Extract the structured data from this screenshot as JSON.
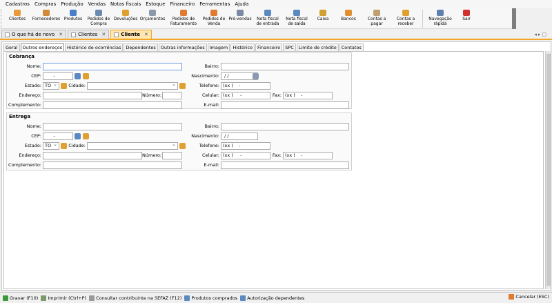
{
  "menu": [
    "Cadastros",
    "Compras",
    "Produção",
    "Vendas",
    "Notas fiscais",
    "Estoque",
    "Financeiro",
    "Ferramentas",
    "Ajuda"
  ],
  "toolbar": [
    {
      "label": "Clientes",
      "icon": "user-icon",
      "color": "#e89a3c"
    },
    {
      "label": "Fornecedores",
      "icon": "supplier-icon",
      "color": "#d08a3a"
    },
    {
      "label": "Produtos",
      "icon": "box-icon",
      "color": "#4a7ec9"
    },
    {
      "label": "Pedidos de\nCompra",
      "icon": "purchase-order-icon",
      "color": "#6a8ab0"
    },
    {
      "label": "Devoluções",
      "icon": "return-icon",
      "color": "#e0a030"
    },
    {
      "label": "Orçamentos",
      "icon": "quote-icon",
      "color": "#8a9aaa"
    },
    {
      "label": "Pedidos de\nFaturamento",
      "icon": "billing-order-icon",
      "color": "#e07a30"
    },
    {
      "label": "Pedidos de\nVenda",
      "icon": "sales-order-icon",
      "color": "#e07a30"
    },
    {
      "label": "Pré-vendas",
      "icon": "cart-icon",
      "color": "#7a8aa0"
    },
    {
      "label": "Nota fiscal\nde entrada",
      "icon": "invoice-in-icon",
      "color": "#5a8ac0"
    },
    {
      "label": "Nota fiscal\nde saída",
      "icon": "invoice-out-icon",
      "color": "#5a8ac0"
    },
    {
      "label": "Caixa",
      "icon": "cashier-icon",
      "color": "#d0a030"
    },
    {
      "label": "Bancos",
      "icon": "bank-icon",
      "color": "#e09030"
    },
    {
      "label": "Contas a\npagar",
      "icon": "payable-icon",
      "color": "#c0a070"
    },
    {
      "label": "Contas a\nreceber",
      "icon": "receivable-icon",
      "color": "#e0a030"
    },
    {
      "label": "Navegação\nrápida",
      "icon": "quick-nav-icon",
      "color": "#6080b0"
    },
    {
      "label": "Sair",
      "icon": "power-icon",
      "color": "#d03030"
    }
  ],
  "tabs": [
    {
      "label": "O que há de novo"
    },
    {
      "label": "Clientes"
    },
    {
      "label": "Cliente"
    }
  ],
  "subtabs": [
    "Geral",
    "Outros endereços",
    "Histórico de ocorrências",
    "Dependentes",
    "Outras informações",
    "Imagem",
    "Histórico",
    "Financeiro",
    "SPC",
    "Limite de crédito",
    "Contatos"
  ],
  "cobranca": {
    "title": "Cobrança",
    "nome_label": "Nome:",
    "nome_value": "",
    "cep_label": "CEP:",
    "cep_value": "      -",
    "estado_label": "Estado:",
    "estado_value": "TO",
    "cidade_label": "Cidade:",
    "cidade_value": "",
    "endereco_label": "Endereço:",
    "numero_label": "Número:",
    "complemento_label": "Complemento:",
    "bairro_label": "Bairro:",
    "nascimento_label": "Nascimento:",
    "nascimento_value": " / /",
    "telefone_label": "Telefone:",
    "telefone_value": "(xx )    -",
    "celular_label": "Celular:",
    "celular_value": "(xx )     -",
    "fax_label": "Fax:",
    "fax_value": "(xx )    -",
    "email_label": "E-mail:"
  },
  "entrega": {
    "title": "Entrega",
    "nome_label": "Nome:",
    "cep_label": "CEP:",
    "cep_value": "      -",
    "estado_label": "Estado:",
    "estado_value": "TO",
    "cidade_label": "Cidade:",
    "endereco_label": "Endereço:",
    "numero_label": "Número:",
    "complemento_label": "Complemento:",
    "bairro_label": "Bairro:",
    "nascimento_label": "Nascimento:",
    "nascimento_value": " / /",
    "telefone_label": "Telefone:",
    "telefone_value": "(xx )    -",
    "celular_label": "Celular:",
    "celular_value": "(xx )     -",
    "fax_label": "Fax:",
    "fax_value": "(xx )    -",
    "email_label": "E-mail:"
  },
  "status": {
    "gravar": "Gravar (F10)",
    "imprimir": "Imprimir (Ctrl+P)",
    "consultar": "Consultar contribuinte na SEFAZ (F12)",
    "produtos": "Produtos comprados",
    "autorizacao": "Autorização dependentes",
    "cancelar": "Cancelar (ESC)"
  }
}
